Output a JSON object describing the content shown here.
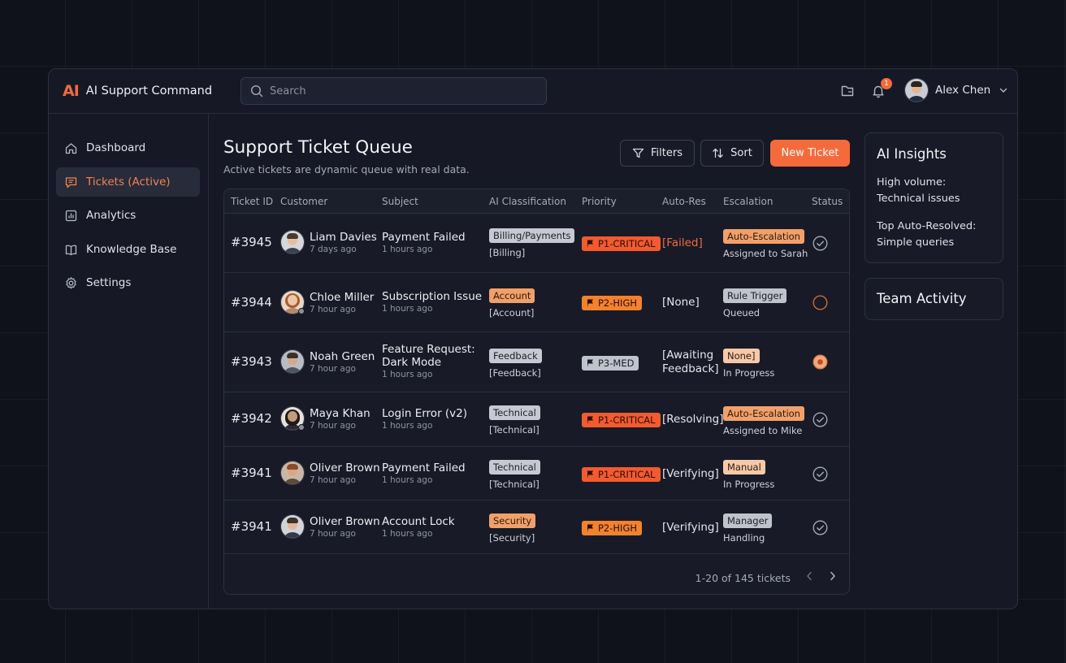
{
  "app": {
    "logo": "AI",
    "title": "AI Support Command"
  },
  "search": {
    "placeholder": "Search"
  },
  "header": {
    "notification_count": "1",
    "user_name": "Alex Chen"
  },
  "sidebar": {
    "items": [
      {
        "label": "Dashboard",
        "icon": "home-icon",
        "active": false
      },
      {
        "label": "Tickets (Active)",
        "icon": "chat-icon",
        "active": true
      },
      {
        "label": "Analytics",
        "icon": "analytics-icon",
        "active": false
      },
      {
        "label": "Knowledge Base",
        "icon": "book-icon",
        "active": false
      },
      {
        "label": "Settings",
        "icon": "gear-icon",
        "active": false
      }
    ]
  },
  "main": {
    "title": "Support Ticket Queue",
    "subtitle": "Active tickets are dynamic queue with real data.",
    "filters_label": "Filters",
    "sort_label": "Sort",
    "new_ticket_label": "New Ticket"
  },
  "table": {
    "columns": [
      "Ticket ID",
      "Customer",
      "Subject",
      "AI Classification",
      "Priority",
      "Auto-Res",
      "Escalation",
      "Status"
    ],
    "rows": [
      {
        "id": "#3945",
        "customer": "Liam Davies",
        "customer_time": "7 days ago",
        "subject": "Payment Failed",
        "subject_time": "1 hours ago",
        "class_tag": "Billing/Payments",
        "class_sub": "[Billing]",
        "priority": "P1-CRITICAL",
        "auto_res": "[Failed]",
        "esc_tag": "Auto-Escalation",
        "esc_sub": "Assigned to Sarah",
        "status": "resolved"
      },
      {
        "id": "#3944",
        "customer": "Chloe Miller",
        "customer_time": "7 hour ago",
        "subject": "Subscription Issue",
        "subject_time": "1 hours ago",
        "class_tag": "Account",
        "class_sub": "[Account]",
        "priority": "P2-HIGH",
        "auto_res": "[None]",
        "esc_tag": "Rule Trigger",
        "esc_sub": "Queued",
        "status": "open"
      },
      {
        "id": "#3943",
        "customer": "Noah Green",
        "customer_time": "7 hour ago",
        "subject": "Feature Request: Dark Mode",
        "subject_time": "1 hours ago",
        "class_tag": "Feedback",
        "class_sub": "[Feedback]",
        "priority": "P3-MED",
        "auto_res": "[Awaiting Feedback]",
        "esc_tag": "None]",
        "esc_sub": "In Progress",
        "status": "in-progress"
      },
      {
        "id": "#3942",
        "customer": "Maya Khan",
        "customer_time": "7 hour ago",
        "subject": "Login Error (v2)",
        "subject_time": "1 hours ago",
        "class_tag": "Technical",
        "class_sub": "[Technical]",
        "priority": "P1-CRITICAL",
        "auto_res": "[Resolving]",
        "esc_tag": "Auto-Escalation",
        "esc_sub": "Assigned to Mike",
        "status": "resolved"
      },
      {
        "id": "#3941",
        "customer": "Oliver Brown",
        "customer_time": "7 hour ago",
        "subject": "Payment Failed",
        "subject_time": "1 hours ago",
        "class_tag": "Technical",
        "class_sub": "[Technical]",
        "priority": "P1-CRITICAL",
        "auto_res": "[Verifying]",
        "esc_tag": "Manual",
        "esc_sub": "In Progress",
        "status": "resolved"
      },
      {
        "id": "#3941",
        "customer": "Oliver Brown",
        "customer_time": "7 hour ago",
        "subject": "Account Lock",
        "subject_time": "1 hours ago",
        "class_tag": "Security",
        "class_sub": "[Security]",
        "priority": "P2-HIGH",
        "auto_res": "[Verifying]",
        "esc_tag": "Manager",
        "esc_sub": "Handling",
        "status": "resolved"
      }
    ],
    "footer": "1-20 of 145 tickets"
  },
  "insights": {
    "title": "AI Insights",
    "line1_label": "High volume:",
    "line1_value": "Technical issues",
    "line2_label": "Top Auto-Resolved:",
    "line2_value": "Simple queries"
  },
  "team": {
    "title": "Team Activity"
  },
  "colors": {
    "accent": "#f46a3a",
    "background": "#10121b",
    "panel": "#181b27"
  }
}
